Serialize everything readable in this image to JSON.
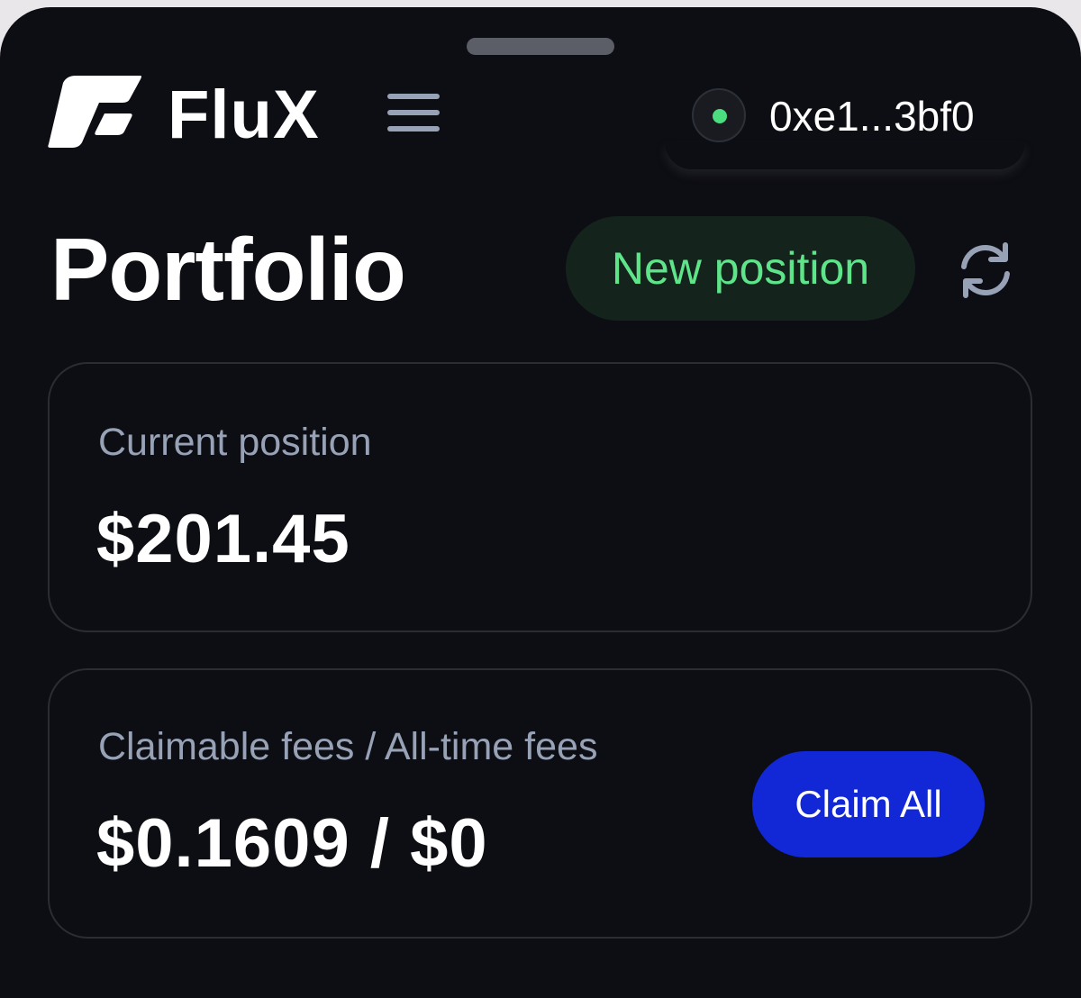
{
  "header": {
    "brand_name": "FluX",
    "wallet": {
      "address": "0xe1...3bf0",
      "status_color": "#4ade80"
    }
  },
  "page": {
    "title": "Portfolio",
    "new_position_label": "New position"
  },
  "current_position": {
    "label": "Current position",
    "value": "$201.45"
  },
  "fees": {
    "label": "Claimable fees / All-time fees",
    "value": "$0.1609 / $0",
    "claim_label": "Claim All"
  },
  "theme": {
    "background": "#0d0e13",
    "accent_green": "#5ee58a",
    "accent_blue": "#1227d6",
    "muted_text": "#98a2b6"
  },
  "icons": {
    "logo": "flux-logo-icon",
    "menu": "hamburger-menu-icon",
    "refresh": "refresh-icon",
    "status": "connection-status-icon"
  }
}
